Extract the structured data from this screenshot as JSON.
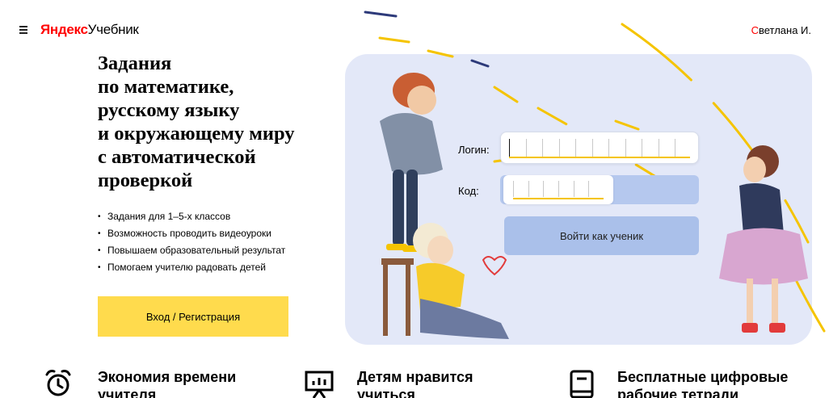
{
  "header": {
    "logo_brand": "Яндекс",
    "logo_product": "Учебник",
    "user_first": "С",
    "user_rest": "ветлана И."
  },
  "hero": {
    "headline_lines": [
      "Задания",
      "по математике,",
      "русскому языку",
      "и окружающему миру",
      "с автоматической",
      "проверкой"
    ],
    "features": [
      "Задания для 1–5-х классов",
      "Возможность проводить видеоуроки",
      "Повышаем образовательный результат",
      "Помогаем учителю радовать детей"
    ],
    "cta_label": "Вход / Регистрация"
  },
  "student_form": {
    "login_label": "Логин:",
    "code_label": "Код:",
    "submit_label": "Войти как ученик"
  },
  "benefits": [
    {
      "icon": "alarm-clock-icon",
      "line1": "Экономия времени",
      "line2": "учителя"
    },
    {
      "icon": "presentation-chart-icon",
      "line1": "Детям нравится",
      "line2": "учиться"
    },
    {
      "icon": "book-icon",
      "line1": "Бесплатные цифровые",
      "line2": "рабочие тетради"
    }
  ],
  "colors": {
    "brand_red": "#ff0000",
    "accent_yellow": "#ffdb4d",
    "panel_bg": "#e3e8f8",
    "student_button": "#aac0ea"
  }
}
